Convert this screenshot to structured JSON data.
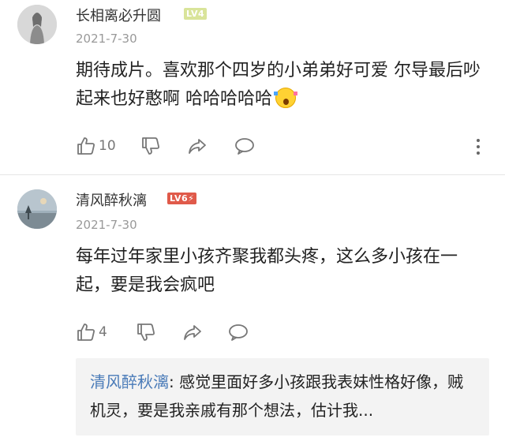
{
  "comments": [
    {
      "username": "长相离必升圆",
      "level": "LV4",
      "date": "2021-7-30",
      "content": "期待成片。喜欢那个四岁的小弟弟好可爱 尔导最后吵起来也好憨啊 哈哈哈哈哈",
      "emoji": "screaming-face-emoji",
      "like_count": "10",
      "level_color": "#d9e49a"
    },
    {
      "username": "清风醉秋漓",
      "level": "LV6",
      "date": "2021-7-30",
      "content": "每年过年家里小孩齐聚我都头疼，这么多小孩在一起，要是我会疯吧",
      "like_count": "4",
      "level_color": "#e05a4a",
      "reply": {
        "author": "清风醉秋漓",
        "separator": ": ",
        "text": "感觉里面好多小孩跟我表妹性格好像，贼机灵，要是我亲戚有那个想法，估计我..."
      }
    }
  ],
  "colors": {
    "reply_name": "#4a7bb8",
    "icon": "#777777"
  }
}
